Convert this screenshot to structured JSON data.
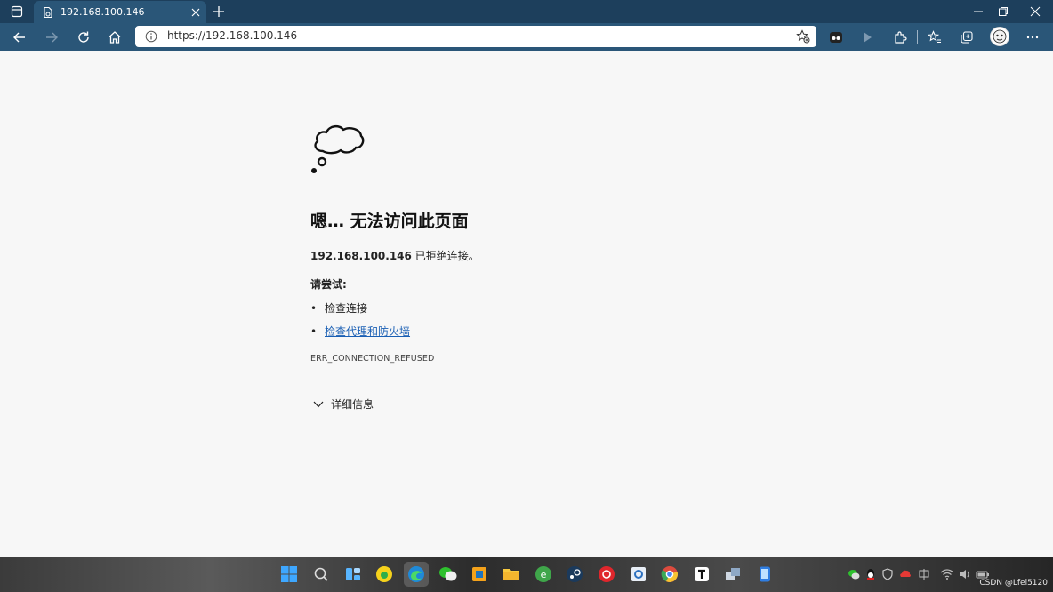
{
  "browser": {
    "tab": {
      "title": "192.168.100.146"
    },
    "address": {
      "url": "https://192.168.100.146"
    }
  },
  "page": {
    "title": "嗯… 无法访问此页面",
    "host": "192.168.100.146",
    "refused_text": " 已拒绝连接。",
    "try_label": "请尝试:",
    "bullet": "•",
    "suggestions": [
      {
        "text": "检查连接",
        "link": false
      },
      {
        "text": "检查代理和防火墙",
        "link": true
      }
    ],
    "error_code": "ERR_CONNECTION_REFUSED",
    "details_label": "详细信息"
  },
  "taskbar": {
    "apps": [
      "windows-start",
      "search",
      "widgets",
      "qq-music",
      "edge",
      "wechat",
      "remote-desktop",
      "file-explorer",
      "browser-e",
      "steam",
      "netease-music",
      "settings",
      "chrome",
      "typora",
      "network-tool",
      "phone-link"
    ],
    "tray": [
      "wechat",
      "qq",
      "security",
      "cloud",
      "input-method",
      "network",
      "volume",
      "battery"
    ]
  },
  "overlay": {
    "watermark": "CSDN @Lfei5120"
  },
  "colors": {
    "titlebar": "#1d3f5c",
    "toolbar": "#2a5678",
    "page_bg": "#f7f7f7",
    "link": "#1a5fb4"
  }
}
